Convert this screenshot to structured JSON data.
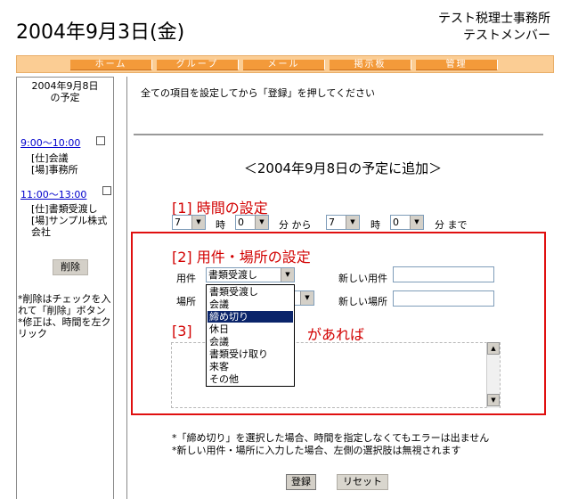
{
  "header": {
    "date": "2004年9月3日(金)",
    "office_name": "テスト税理士事務所",
    "member_name": "テストメンバー"
  },
  "nav": [
    "ホーム",
    "グループ",
    "メール",
    "掲示板",
    "管理"
  ],
  "sidebar": {
    "date_line1": "2004年9月8日",
    "date_line2": "の予定",
    "items": [
      {
        "time": "9:00～10:00",
        "line1": "[仕]会議",
        "line2": "[場]事務所",
        "line3": ""
      },
      {
        "time": "11:00～13:00",
        "line1": "[仕]書類受渡し",
        "line2": "[場]サンプル株式",
        "line3": "会社"
      }
    ],
    "delete_label": "削除",
    "notes": [
      "*削除はチェックを入",
      "れて「削除」ボタン",
      "*修正は、時間を左ク",
      "リック"
    ]
  },
  "main": {
    "instruction": "全ての項目を設定してから「登録」を押してください",
    "form_title": "＜2004年9月8日の予定に追加＞",
    "section1": "[1] 時間の設定",
    "time": {
      "start_hour": "7",
      "start_min": "0",
      "end_hour": "7",
      "end_min": "0",
      "hour_label": "時",
      "min_label_from": "分 から",
      "min_label_to": "分 まで"
    },
    "section2": "[2] 用件・場所の設定",
    "purpose_label": "用件",
    "purpose_value": "書類受渡し",
    "new_purpose_label": "新しい用件",
    "place_label": "場所",
    "new_place_label": "新しい場所",
    "section3_start": "[3]",
    "section3_end": "があれば",
    "dropdown_options": [
      "書類受渡し",
      "会議",
      "締め切り",
      "休日",
      "会議",
      "書類受け取り",
      "来客",
      "その他"
    ],
    "dropdown_highlight": "締め切り",
    "note1": "*「締め切り」を選択した場合、時間を指定しなくてもエラーは出ません",
    "note2": "*新しい用件・場所に入力した場合、左側の選択肢は無視されます",
    "register_label": "登録",
    "reset_label": "リセット"
  },
  "colors": {
    "nav_bg": "#fbcd94",
    "nav_button": "#f39a3a",
    "section_red": "#d20000",
    "highlight_box": "#e01010",
    "selected_option": "#0a246a",
    "link_blue": "#0000cc"
  }
}
